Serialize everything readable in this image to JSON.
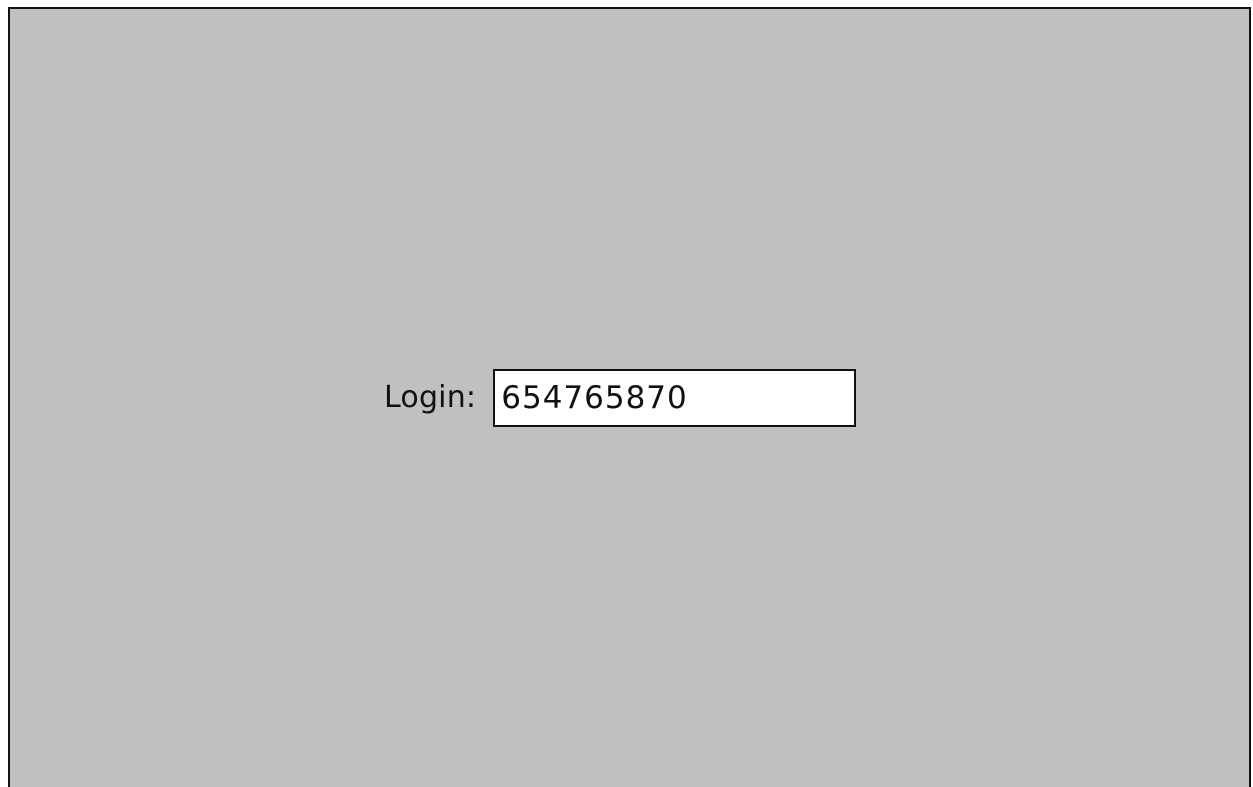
{
  "login": {
    "label": "Login:",
    "value": "654765870"
  }
}
